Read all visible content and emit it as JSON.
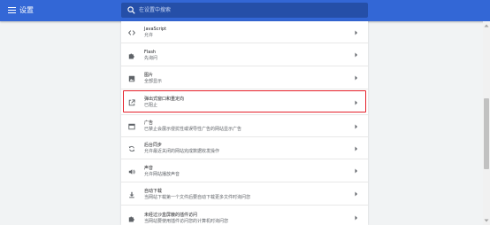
{
  "header": {
    "title": "设置",
    "search_placeholder": "在设置中搜索"
  },
  "rows": [
    {
      "icon": "code-icon",
      "title": "JavaScript",
      "subtitle": "允许"
    },
    {
      "icon": "puzzle-icon",
      "title": "Flash",
      "subtitle": "先询问"
    },
    {
      "icon": "image-icon",
      "title": "图片",
      "subtitle": "全部显示"
    },
    {
      "icon": "open-in-new-icon",
      "title": "弹出式窗口和重定向",
      "subtitle": "已阻止"
    },
    {
      "icon": "ad-icon",
      "title": "广告",
      "subtitle": "已禁止会展示侵扰性或误导性广告的网站显示广告"
    },
    {
      "icon": "sync-icon",
      "title": "后台同步",
      "subtitle": "允许最近关闭的网站完成数据收发操作"
    },
    {
      "icon": "volume-icon",
      "title": "声音",
      "subtitle": "允许网站播放声音"
    },
    {
      "icon": "download-icon",
      "title": "自动下载",
      "subtitle": "当网站下载第一个文件后要自动下载更多文件时询问您"
    },
    {
      "icon": "puzzle-icon",
      "title": "未经过沙盒屏蔽的插件访问",
      "subtitle": "当网站要使用插件访问您的计算机时询问您"
    }
  ],
  "colors": {
    "header_bg": "#3367d6",
    "highlight_border": "#e5202a"
  }
}
